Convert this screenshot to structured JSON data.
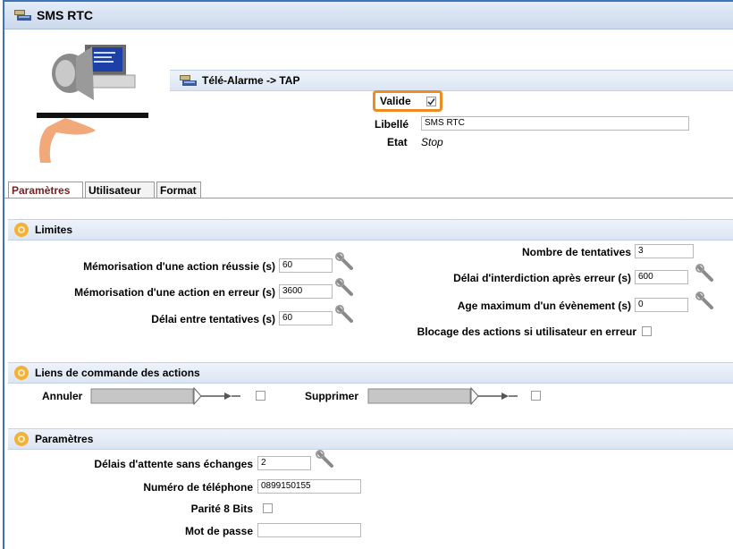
{
  "window": {
    "title": "SMS RTC"
  },
  "header": {
    "breadcrumb": "Télé-Alarme -> TAP"
  },
  "general": {
    "valide_label": "Valide",
    "valide_checked": true,
    "libelle_label": "Libellé",
    "libelle_value": "SMS RTC",
    "etat_label": "Etat",
    "etat_value": "Stop"
  },
  "tabs": [
    {
      "label": "Paramètres",
      "active": true
    },
    {
      "label": "Utilisateur",
      "active": false
    },
    {
      "label": "Format",
      "active": false
    }
  ],
  "limites": {
    "title": "Limites",
    "memo_reussie_label": "Mémorisation d'une action réussie (s)",
    "memo_reussie_value": "60",
    "memo_erreur_label": "Mémorisation d'une action en erreur (s)",
    "memo_erreur_value": "3600",
    "delai_tentatives_label": "Délai entre tentatives (s)",
    "delai_tentatives_value": "60",
    "nb_tentatives_label": "Nombre de tentatives",
    "nb_tentatives_value": "3",
    "delai_interdiction_label": "Délai d'interdiction après erreur (s)",
    "delai_interdiction_value": "600",
    "age_max_label": "Age maximum d'un évènement (s)",
    "age_max_value": "0",
    "blocage_label": "Blocage des actions si utilisateur en erreur"
  },
  "liens": {
    "title": "Liens de commande des actions",
    "annuler_label": "Annuler",
    "supprimer_label": "Supprimer"
  },
  "parametres": {
    "title": "Paramètres",
    "delais_label": "Délais d'attente sans échanges",
    "delais_value": "2",
    "telephone_label": "Numéro de téléphone",
    "telephone_value": "0899150155",
    "parite_label": "Parité 8 Bits",
    "motdepasse_label": "Mot de passe",
    "motdepasse_value": ""
  },
  "colors": {
    "accent": "#3f73b7",
    "highlight": "#f08a24",
    "active_tab": "#7a1e1e"
  }
}
